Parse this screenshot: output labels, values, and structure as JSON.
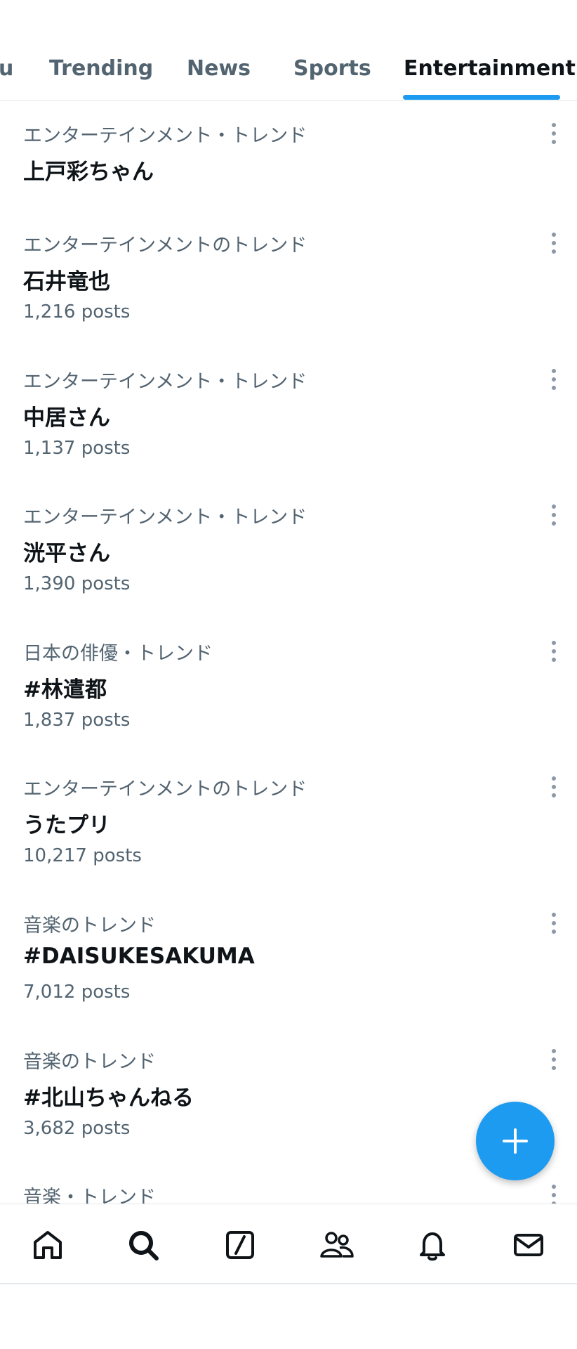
{
  "tabs": {
    "partial_label": "u",
    "items": [
      {
        "label": "Trending"
      },
      {
        "label": "News"
      },
      {
        "label": "Sports"
      },
      {
        "label": "Entertainment",
        "active": true
      }
    ]
  },
  "trends": [
    {
      "category": "エンターテインメント・トレンド",
      "topic": "上戸彩ちゃん",
      "posts": ""
    },
    {
      "category": "エンターテインメントのトレンド",
      "topic": "石井竜也",
      "posts": "1,216 posts"
    },
    {
      "category": "エンターテインメント・トレンド",
      "topic": "中居さん",
      "posts": "1,137 posts"
    },
    {
      "category": "エンターテインメント・トレンド",
      "topic": "洸平さん",
      "posts": "1,390 posts"
    },
    {
      "category": "日本の俳優・トレンド",
      "topic": "#林遣都",
      "posts": "1,837 posts"
    },
    {
      "category": "エンターテインメントのトレンド",
      "topic": "うたプリ",
      "posts": "10,217 posts"
    },
    {
      "category": "音楽のトレンド",
      "topic": "#DAISUKESAKUMA",
      "posts": "7,012 posts"
    },
    {
      "category": "音楽のトレンド",
      "topic": "#北山ちゃんねる",
      "posts": "3,682 posts"
    },
    {
      "category": "音楽・トレンド",
      "topic": "",
      "posts": ""
    }
  ],
  "icons": {
    "fab": "plus-icon",
    "nav": [
      "home-icon",
      "search-icon",
      "grok-icon",
      "communities-icon",
      "notifications-icon",
      "messages-icon"
    ],
    "more": "more-vertical-icon"
  },
  "colors": {
    "accent": "#1d9bf0",
    "text_primary": "#0f1419",
    "text_secondary": "#536471"
  }
}
